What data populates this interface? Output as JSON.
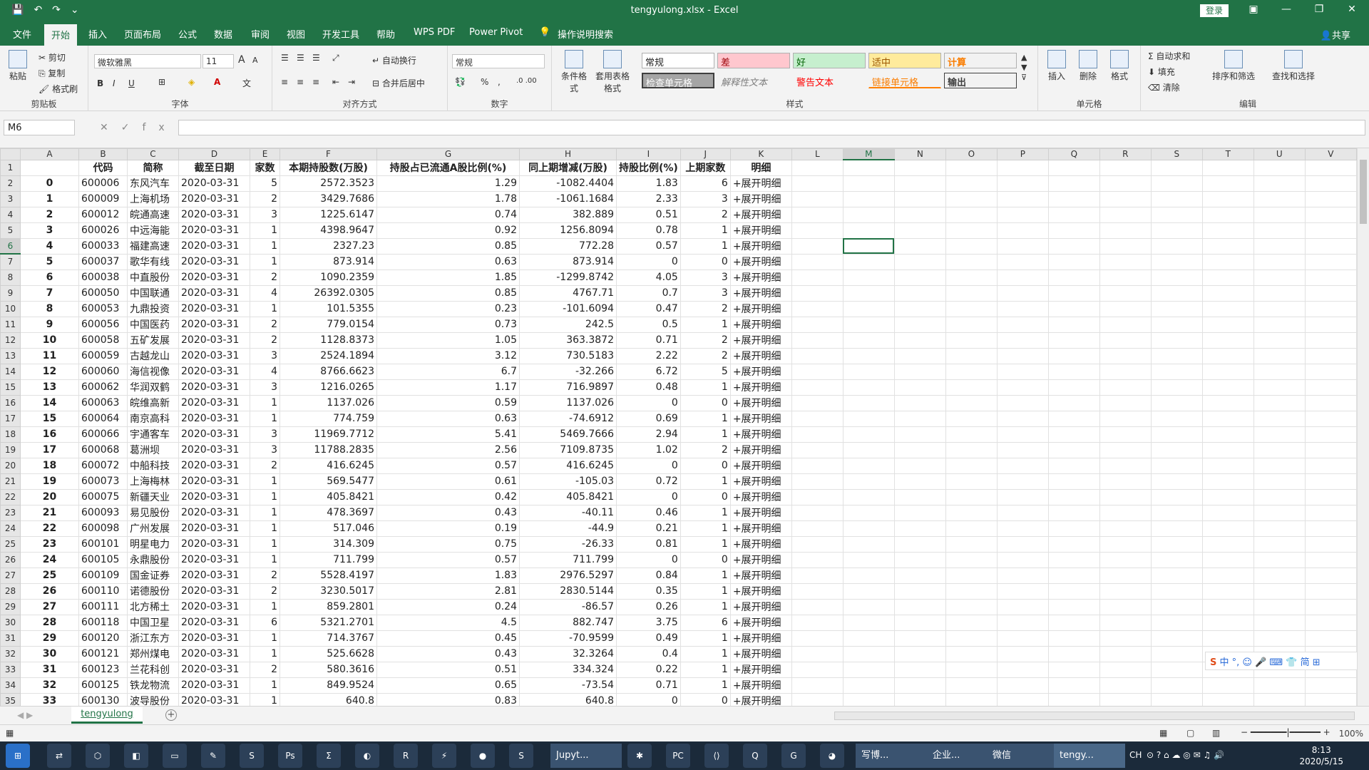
{
  "app": {
    "filename": "tengyulong.xlsx",
    "appname": "Excel",
    "window_title": "tengyulong.xlsx  -  Excel",
    "login": "登录",
    "share": "共享"
  },
  "menu": {
    "tabs": [
      "文件",
      "开始",
      "插入",
      "页面布局",
      "公式",
      "数据",
      "审阅",
      "视图",
      "开发工具",
      "帮助",
      "WPS PDF",
      "Power Pivot",
      "操作说明搜索"
    ],
    "active": "开始"
  },
  "ribbon": {
    "clipboard": {
      "paste": "粘贴",
      "cut": "剪切",
      "copy": "复制",
      "format_painter": "格式刷",
      "label": "剪贴板"
    },
    "font": {
      "name": "微软雅黑",
      "size": "11",
      "bold": "B",
      "italic": "I",
      "underline": "U",
      "grow": "A",
      "shrink": "A",
      "label": "字体"
    },
    "alignment": {
      "wrap": "自动换行",
      "merge": "合并后居中",
      "label": "对齐方式"
    },
    "number": {
      "format": "常规",
      "percent": "%",
      "comma": ",",
      "label": "数字"
    },
    "styles": {
      "conditional": "条件格式",
      "table": "套用表格格式",
      "normal": "常规",
      "bad": "差",
      "good": "好",
      "neutral": "适中",
      "calc": "计算",
      "check": "检查单元格",
      "explanatory": "解释性文本",
      "warning": "警告文本",
      "linked": "链接单元格",
      "output": "输出",
      "label": "样式"
    },
    "cells": {
      "insert": "插入",
      "delete": "删除",
      "format": "格式",
      "label": "单元格"
    },
    "editing": {
      "autosum": "自动求和",
      "fill": "填充",
      "clear": "清除",
      "sort": "排序和筛选",
      "find": "查找和选择",
      "label": "编辑"
    }
  },
  "formula_bar": {
    "name_box": "M6",
    "fx": "fx",
    "value": ""
  },
  "columns": [
    "A",
    "B",
    "C",
    "D",
    "E",
    "F",
    "G",
    "H",
    "I",
    "J",
    "K",
    "L",
    "M",
    "N",
    "O",
    "P",
    "Q",
    "R",
    "S",
    "T",
    "U",
    "V"
  ],
  "selected_column": "M",
  "selected_row": 6,
  "headers": [
    "",
    "代码",
    "简称",
    "截至日期",
    "家数",
    "本期持股数(万股)",
    "持股占已流通A股比例(%)",
    "同上期增减(万股)",
    "持股比例(%)",
    "上期家数",
    "明细"
  ],
  "rows": [
    [
      "0",
      "600006",
      "东风汽车",
      "2020-03-31",
      "5",
      "2572.3523",
      "1.29",
      "-1082.4404",
      "1.83",
      "6",
      "+展开明细"
    ],
    [
      "1",
      "600009",
      "上海机场",
      "2020-03-31",
      "2",
      "3429.7686",
      "1.78",
      "-1061.1684",
      "2.33",
      "3",
      "+展开明细"
    ],
    [
      "2",
      "600012",
      "皖通高速",
      "2020-03-31",
      "3",
      "1225.6147",
      "0.74",
      "382.889",
      "0.51",
      "2",
      "+展开明细"
    ],
    [
      "3",
      "600026",
      "中远海能",
      "2020-03-31",
      "1",
      "4398.9647",
      "0.92",
      "1256.8094",
      "0.78",
      "1",
      "+展开明细"
    ],
    [
      "4",
      "600033",
      "福建高速",
      "2020-03-31",
      "1",
      "2327.23",
      "0.85",
      "772.28",
      "0.57",
      "1",
      "+展开明细"
    ],
    [
      "5",
      "600037",
      "歌华有线",
      "2020-03-31",
      "1",
      "873.914",
      "0.63",
      "873.914",
      "0",
      "0",
      "+展开明细"
    ],
    [
      "6",
      "600038",
      "中直股份",
      "2020-03-31",
      "2",
      "1090.2359",
      "1.85",
      "-1299.8742",
      "4.05",
      "3",
      "+展开明细"
    ],
    [
      "7",
      "600050",
      "中国联通",
      "2020-03-31",
      "4",
      "26392.0305",
      "0.85",
      "4767.71",
      "0.7",
      "3",
      "+展开明细"
    ],
    [
      "8",
      "600053",
      "九鼎投资",
      "2020-03-31",
      "1",
      "101.5355",
      "0.23",
      "-101.6094",
      "0.47",
      "2",
      "+展开明细"
    ],
    [
      "9",
      "600056",
      "中国医药",
      "2020-03-31",
      "2",
      "779.0154",
      "0.73",
      "242.5",
      "0.5",
      "1",
      "+展开明细"
    ],
    [
      "10",
      "600058",
      "五矿发展",
      "2020-03-31",
      "2",
      "1128.8373",
      "1.05",
      "363.3872",
      "0.71",
      "2",
      "+展开明细"
    ],
    [
      "11",
      "600059",
      "古越龙山",
      "2020-03-31",
      "3",
      "2524.1894",
      "3.12",
      "730.5183",
      "2.22",
      "2",
      "+展开明细"
    ],
    [
      "12",
      "600060",
      "海信视像",
      "2020-03-31",
      "4",
      "8766.6623",
      "6.7",
      "-32.266",
      "6.72",
      "5",
      "+展开明细"
    ],
    [
      "13",
      "600062",
      "华润双鹤",
      "2020-03-31",
      "3",
      "1216.0265",
      "1.17",
      "716.9897",
      "0.48",
      "1",
      "+展开明细"
    ],
    [
      "14",
      "600063",
      "皖维高新",
      "2020-03-31",
      "1",
      "1137.026",
      "0.59",
      "1137.026",
      "0",
      "0",
      "+展开明细"
    ],
    [
      "15",
      "600064",
      "南京高科",
      "2020-03-31",
      "1",
      "774.759",
      "0.63",
      "-74.6912",
      "0.69",
      "1",
      "+展开明细"
    ],
    [
      "16",
      "600066",
      "宇通客车",
      "2020-03-31",
      "3",
      "11969.7712",
      "5.41",
      "5469.7666",
      "2.94",
      "1",
      "+展开明细"
    ],
    [
      "17",
      "600068",
      "葛洲坝",
      "2020-03-31",
      "3",
      "11788.2835",
      "2.56",
      "7109.8735",
      "1.02",
      "2",
      "+展开明细"
    ],
    [
      "18",
      "600072",
      "中船科技",
      "2020-03-31",
      "2",
      "416.6245",
      "0.57",
      "416.6245",
      "0",
      "0",
      "+展开明细"
    ],
    [
      "19",
      "600073",
      "上海梅林",
      "2020-03-31",
      "1",
      "569.5477",
      "0.61",
      "-105.03",
      "0.72",
      "1",
      "+展开明细"
    ],
    [
      "20",
      "600075",
      "新疆天业",
      "2020-03-31",
      "1",
      "405.8421",
      "0.42",
      "405.8421",
      "0",
      "0",
      "+展开明细"
    ],
    [
      "21",
      "600093",
      "易见股份",
      "2020-03-31",
      "1",
      "478.3697",
      "0.43",
      "-40.11",
      "0.46",
      "1",
      "+展开明细"
    ],
    [
      "22",
      "600098",
      "广州发展",
      "2020-03-31",
      "1",
      "517.046",
      "0.19",
      "-44.9",
      "0.21",
      "1",
      "+展开明细"
    ],
    [
      "23",
      "600101",
      "明星电力",
      "2020-03-31",
      "1",
      "314.309",
      "0.75",
      "-26.33",
      "0.81",
      "1",
      "+展开明细"
    ],
    [
      "24",
      "600105",
      "永鼎股份",
      "2020-03-31",
      "1",
      "711.799",
      "0.57",
      "711.799",
      "0",
      "0",
      "+展开明细"
    ],
    [
      "25",
      "600109",
      "国金证券",
      "2020-03-31",
      "2",
      "5528.4197",
      "1.83",
      "2976.5297",
      "0.84",
      "1",
      "+展开明细"
    ],
    [
      "26",
      "600110",
      "诺德股份",
      "2020-03-31",
      "2",
      "3230.5017",
      "2.81",
      "2830.5144",
      "0.35",
      "1",
      "+展开明细"
    ],
    [
      "27",
      "600111",
      "北方稀土",
      "2020-03-31",
      "1",
      "859.2801",
      "0.24",
      "-86.57",
      "0.26",
      "1",
      "+展开明细"
    ],
    [
      "28",
      "600118",
      "中国卫星",
      "2020-03-31",
      "6",
      "5321.2701",
      "4.5",
      "882.747",
      "3.75",
      "6",
      "+展开明细"
    ],
    [
      "29",
      "600120",
      "浙江东方",
      "2020-03-31",
      "1",
      "714.3767",
      "0.45",
      "-70.9599",
      "0.49",
      "1",
      "+展开明细"
    ],
    [
      "30",
      "600121",
      "郑州煤电",
      "2020-03-31",
      "1",
      "525.6628",
      "0.43",
      "32.3264",
      "0.4",
      "1",
      "+展开明细"
    ],
    [
      "31",
      "600123",
      "兰花科创",
      "2020-03-31",
      "2",
      "580.3616",
      "0.51",
      "334.324",
      "0.22",
      "1",
      "+展开明细"
    ],
    [
      "32",
      "600125",
      "铁龙物流",
      "2020-03-31",
      "1",
      "849.9524",
      "0.65",
      "-73.54",
      "0.71",
      "1",
      "+展开明细"
    ],
    [
      "33",
      "600130",
      "波导股份",
      "2020-03-31",
      "1",
      "640.8",
      "0.83",
      "640.8",
      "0",
      "0",
      "+展开明细"
    ]
  ],
  "sheet_tab": "tengyulong",
  "zoom": "100%",
  "ime": "中 °, ☺ 🎤 ⌨ 👕 简 ⊞",
  "taskbar": {
    "apps": [
      "Jupyt...",
      "写博...",
      "企业...",
      "微信",
      "tengy..."
    ],
    "time": "8:13",
    "date": "2020/5/15",
    "tray": "CH"
  }
}
